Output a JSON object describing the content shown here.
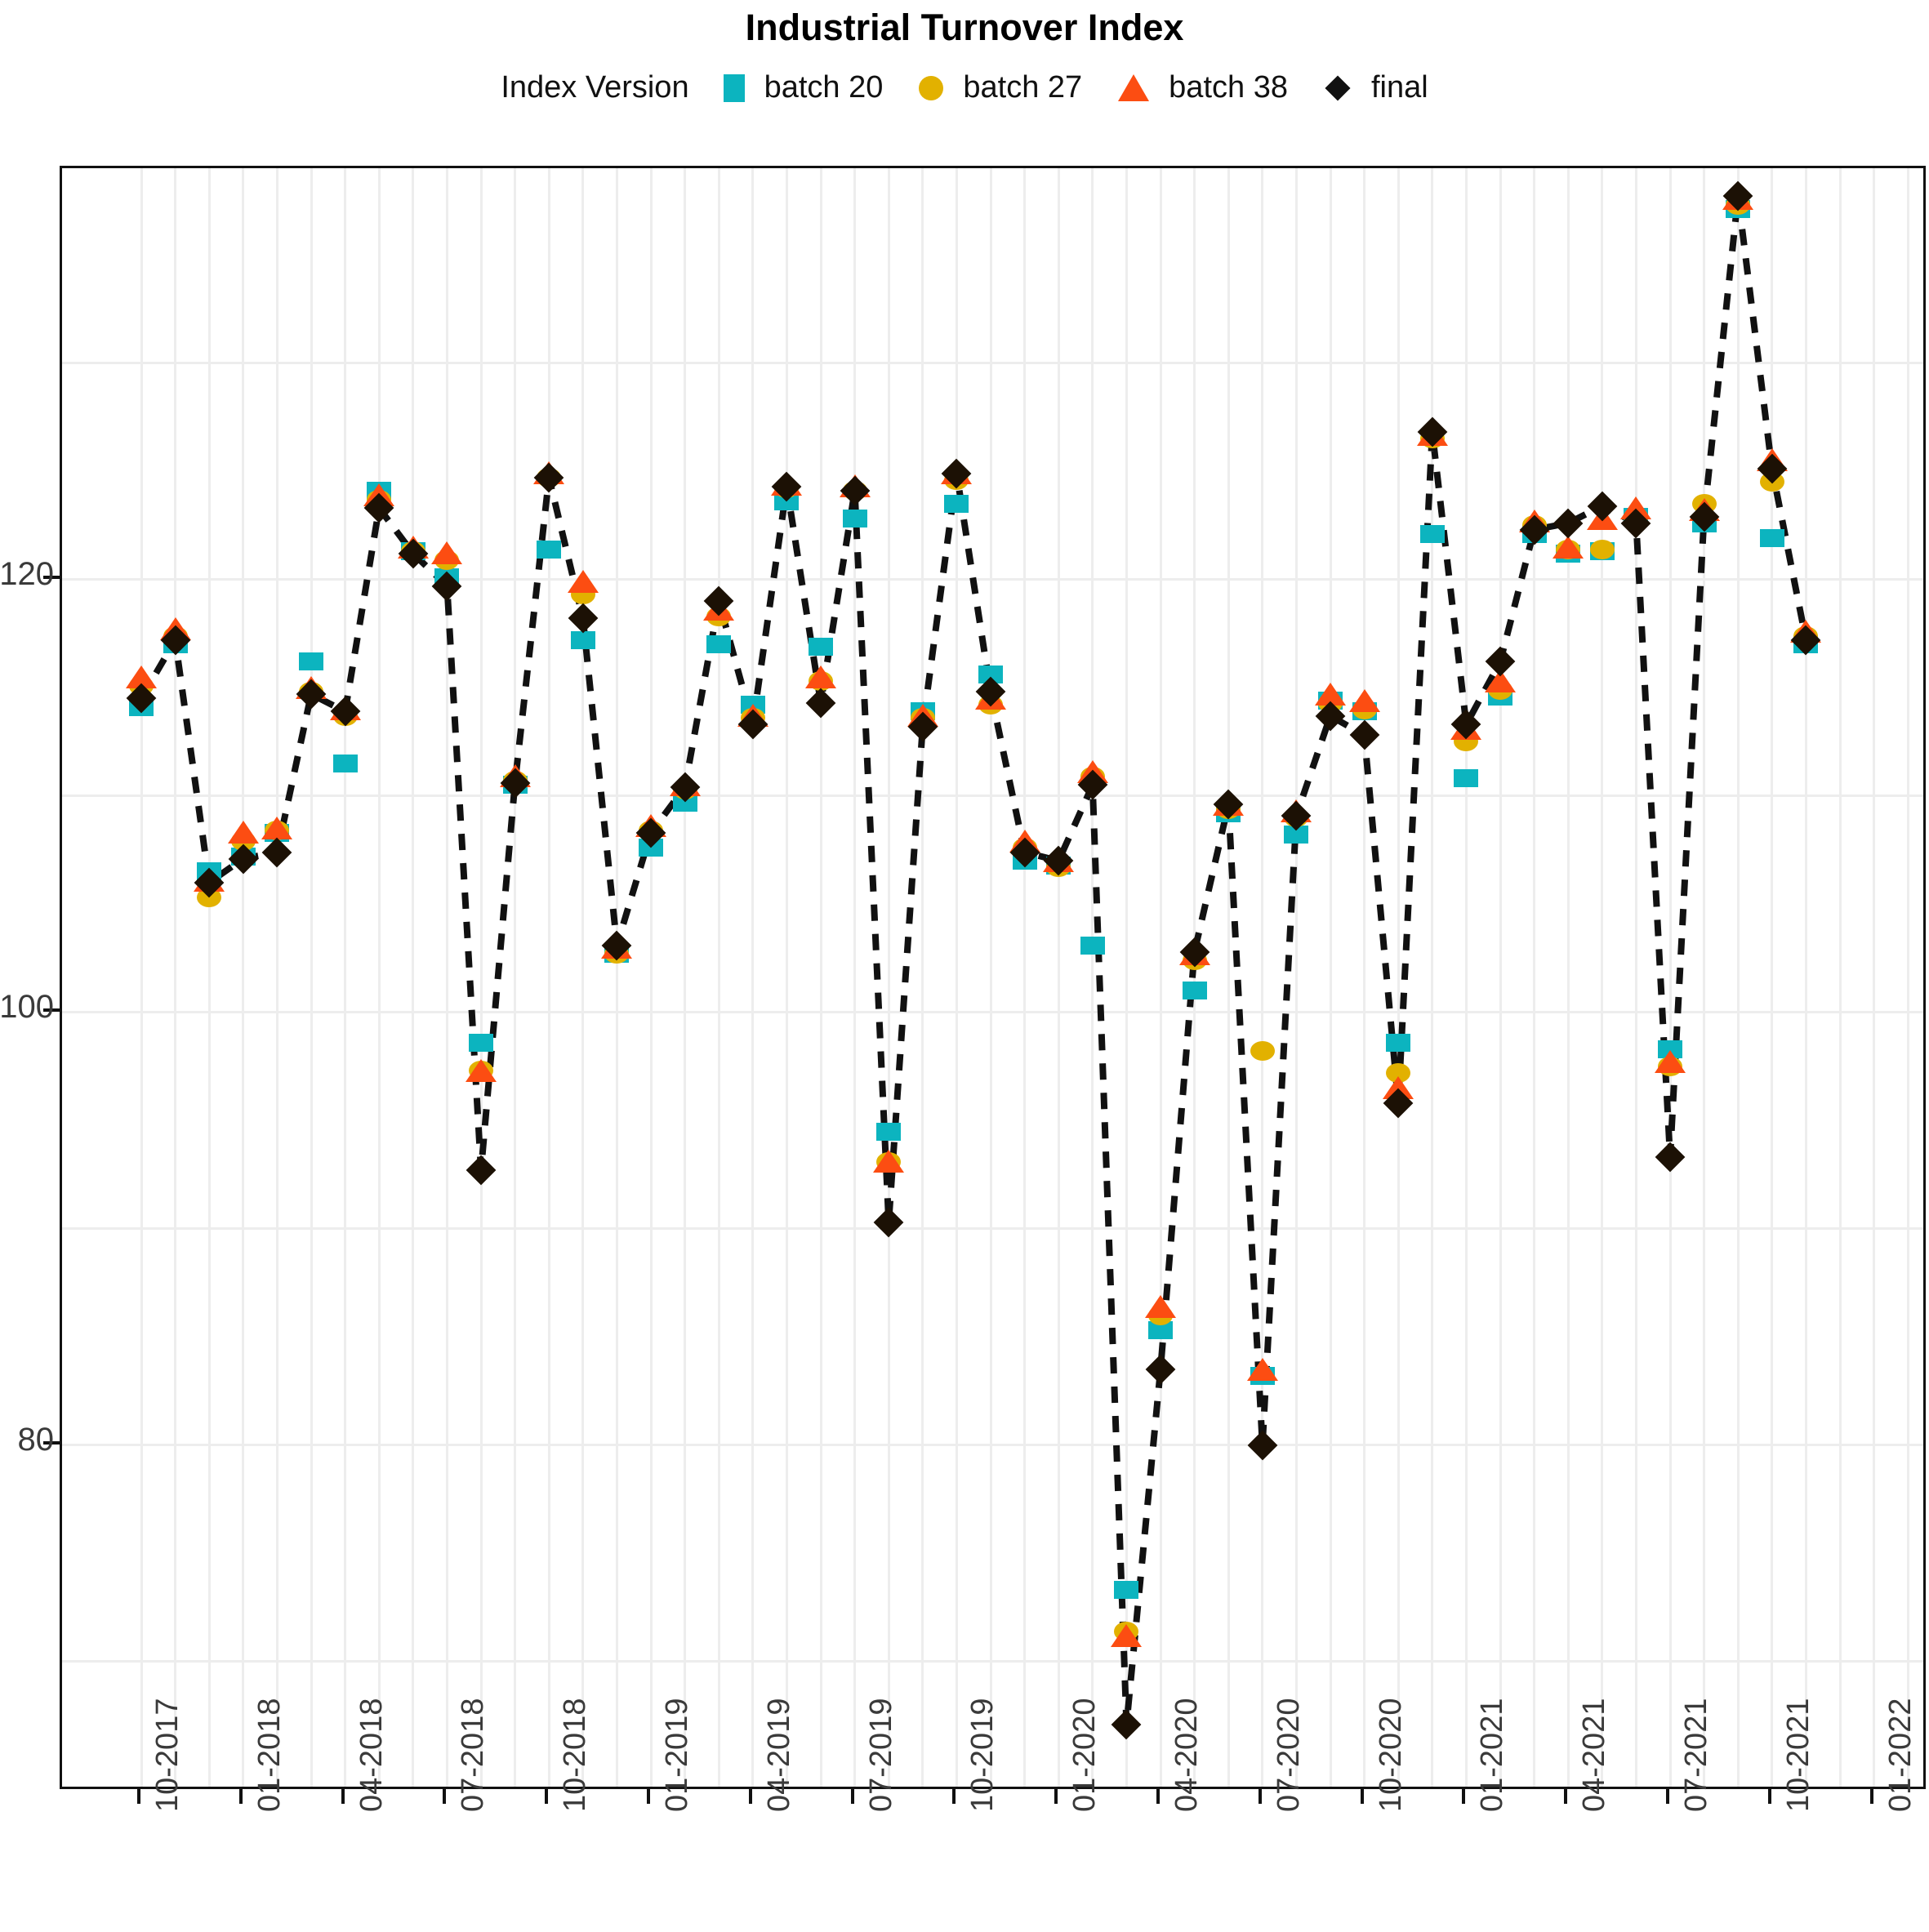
{
  "title": "Industrial Turnover Index",
  "legend": {
    "title": "Index Version",
    "entries": [
      {
        "label": "batch 20",
        "marker": "square-icon",
        "color": "#0CB4BF"
      },
      {
        "label": "batch 27",
        "marker": "circle-icon",
        "color": "#E2B100"
      },
      {
        "label": "batch 38",
        "marker": "triangle-icon",
        "color": "#FC4D12"
      },
      {
        "label": "final",
        "marker": "diamond-icon",
        "color": "#1C1105"
      }
    ]
  },
  "chart_data": {
    "type": "scatter",
    "title": "Industrial Turnover Index",
    "xlabel": "",
    "ylabel": "",
    "ylim": [
      64,
      139
    ],
    "yticks": [
      80,
      100,
      120
    ],
    "grid": true,
    "legend_position": "top",
    "xticks": [
      "10-2017",
      "01-2018",
      "04-2018",
      "07-2018",
      "10-2018",
      "01-2019",
      "04-2019",
      "07-2019",
      "10-2019",
      "01-2020",
      "04-2020",
      "07-2020",
      "10-2020",
      "01-2021",
      "04-2021",
      "07-2021",
      "10-2021",
      "01-2022"
    ],
    "x": [
      "10-2017",
      "11-2017",
      "12-2017",
      "01-2018",
      "02-2018",
      "03-2018",
      "04-2018",
      "05-2018",
      "06-2018",
      "07-2018",
      "08-2018",
      "09-2018",
      "10-2018",
      "11-2018",
      "12-2018",
      "01-2019",
      "02-2019",
      "03-2019",
      "04-2019",
      "05-2019",
      "06-2019",
      "07-2019",
      "08-2019",
      "09-2019",
      "10-2019",
      "11-2019",
      "12-2019",
      "01-2020",
      "02-2020",
      "03-2020",
      "04-2020",
      "05-2020",
      "06-2020",
      "07-2020",
      "08-2020",
      "09-2020",
      "10-2020",
      "11-2020",
      "12-2020",
      "01-2021",
      "02-2021",
      "03-2021",
      "04-2021",
      "05-2021",
      "06-2021",
      "07-2021",
      "08-2021",
      "09-2021",
      "10-2021",
      "11-2021",
      "12-2021",
      "01-2022"
    ],
    "series": [
      {
        "name": "batch 20",
        "marker": "square",
        "color": "#0CB4BF",
        "values": [
          114.1,
          117.0,
          106.5,
          107.2,
          108.3,
          116.2,
          111.5,
          124.1,
          121.3,
          120.1,
          98.6,
          110.5,
          121.4,
          117.2,
          102.7,
          107.6,
          109.7,
          117.0,
          114.2,
          123.6,
          116.9,
          122.8,
          94.5,
          113.9,
          123.5,
          115.6,
          107.0,
          106.8,
          103.1,
          73.3,
          85.3,
          101.0,
          109.2,
          83.2,
          108.2,
          114.4,
          113.9,
          98.6,
          122.1,
          110.8,
          114.6,
          122.1,
          121.2,
          121.3,
          122.9,
          98.3,
          122.6,
          137.1,
          121.9,
          117.0
        ]
      },
      {
        "name": "batch 27",
        "marker": "circle",
        "color": "#E2B100",
        "values": [
          115.1,
          117.4,
          105.3,
          107.9,
          108.4,
          114.8,
          113.7,
          123.7,
          121.3,
          120.9,
          97.3,
          110.7,
          124.7,
          119.3,
          102.7,
          108.4,
          110.3,
          118.3,
          113.6,
          124.2,
          115.3,
          124.1,
          93.1,
          113.6,
          124.6,
          114.2,
          107.6,
          106.7,
          110.9,
          71.4,
          86.0,
          102.4,
          109.4,
          98.2,
          109.0,
          114.3,
          114.0,
          97.2,
          126.5,
          112.5,
          114.9,
          122.5,
          121.4,
          121.4,
          122.9,
          97.5,
          123.5,
          137.3,
          124.5,
          117.4
        ]
      },
      {
        "name": "batch 38",
        "marker": "triangle",
        "color": "#FC4D12",
        "values": [
          115.4,
          117.6,
          106.0,
          108.2,
          108.4,
          114.9,
          113.9,
          123.8,
          121.4,
          121.1,
          97.2,
          110.8,
          124.8,
          119.8,
          102.9,
          108.5,
          110.4,
          118.5,
          113.6,
          124.3,
          115.4,
          124.2,
          93.0,
          113.6,
          124.8,
          114.4,
          107.8,
          106.9,
          111.0,
          71.1,
          86.3,
          102.6,
          109.5,
          83.4,
          109.2,
          114.6,
          114.3,
          96.4,
          126.6,
          113.0,
          115.2,
          122.6,
          121.4,
          122.7,
          123.2,
          97.6,
          123.1,
          137.5,
          125.4,
          117.5
        ]
      },
      {
        "name": "final",
        "marker": "diamond",
        "color": "#1C1105",
        "values": [
          114.5,
          117.2,
          106.0,
          107.1,
          107.4,
          114.7,
          113.9,
          123.3,
          121.2,
          119.7,
          92.7,
          110.6,
          124.7,
          118.2,
          103.1,
          108.3,
          110.4,
          119.0,
          113.3,
          124.3,
          114.3,
          124.1,
          90.3,
          113.2,
          124.9,
          114.8,
          107.4,
          107.0,
          110.5,
          67.1,
          83.5,
          102.8,
          109.6,
          80.0,
          109.1,
          113.7,
          112.8,
          95.8,
          126.8,
          113.3,
          116.2,
          122.3,
          122.6,
          123.4,
          122.6,
          93.3,
          122.9,
          137.7,
          125.1,
          117.2
        ]
      }
    ]
  }
}
